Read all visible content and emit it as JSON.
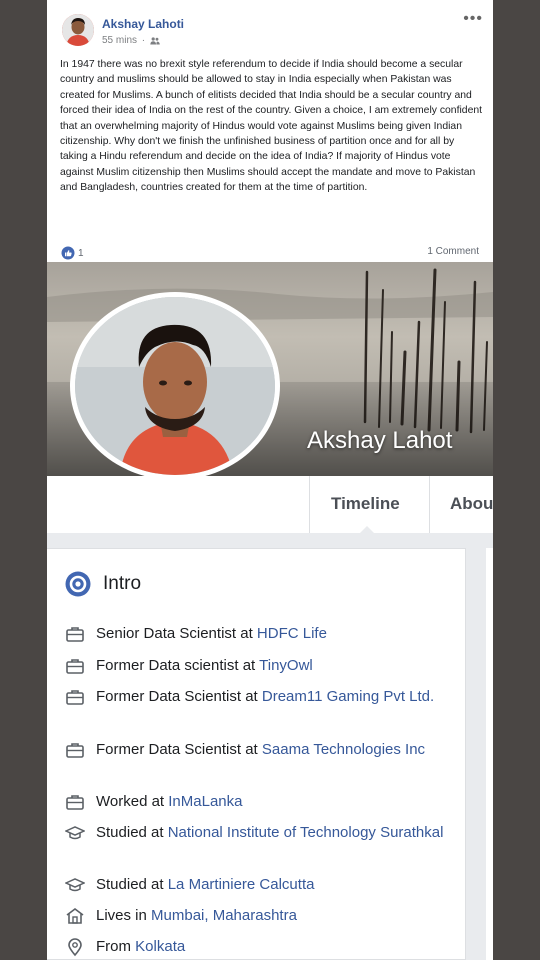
{
  "post": {
    "author": "Akshay Lahoti",
    "time": "55 mins",
    "body": "In 1947 there was no brexit style referendum to decide if India should become a secular country and muslims should be allowed to stay in India especially when Pakistan was created for Muslims. A bunch of elitists decided that India should be a secular country and forced their idea of India on the rest of the country. Given a choice, I am extremely confident that an overwhelming majority of Hindus would vote against Muslims being given Indian citizenship. Why don't we finish the unfinished business of partition once and for all by taking a Hindu referendum and decide on the idea of India? If majority of Hindus vote against Muslim citizenship then Muslims should accept the mandate and move to Pakistan and Bangladesh, countries created for them at the time of partition.",
    "reaction_count": "1",
    "comment_count": "1 Comment",
    "more_icon": "more-icon"
  },
  "profile": {
    "name": "Akshay Lahot",
    "tabs": [
      "Timeline",
      "Abou"
    ]
  },
  "intro": {
    "title": "Intro",
    "items": [
      {
        "icon": "briefcase-icon",
        "prefix": "Senior Data Scientist at ",
        "link": "HDFC Life"
      },
      {
        "icon": "briefcase-icon",
        "prefix": "Former Data scientist at ",
        "link": "TinyOwl"
      },
      {
        "icon": "briefcase-icon",
        "prefix": "Former Data Scientist at ",
        "link": "Dream11 Gaming Pvt Ltd."
      },
      {
        "icon": "briefcase-icon",
        "prefix": "Former Data Scientist at ",
        "link": "Saama Technologies Inc"
      },
      {
        "icon": "briefcase-icon",
        "prefix": "Worked at ",
        "link": "InMaLanka"
      },
      {
        "icon": "graduation-cap-icon",
        "prefix": "Studied at ",
        "link": "National Institute of Technology Surathkal"
      },
      {
        "icon": "graduation-cap-icon",
        "prefix": "Studied at ",
        "link": "La Martiniere Calcutta"
      },
      {
        "icon": "home-icon",
        "prefix": "Lives in ",
        "link": "Mumbai, Maharashtra"
      },
      {
        "icon": "location-pin-icon",
        "prefix": "From ",
        "link": "Kolkata"
      }
    ]
  },
  "colors": {
    "link": "#365899",
    "background": "#4a4644",
    "accent": "#4267b2"
  }
}
